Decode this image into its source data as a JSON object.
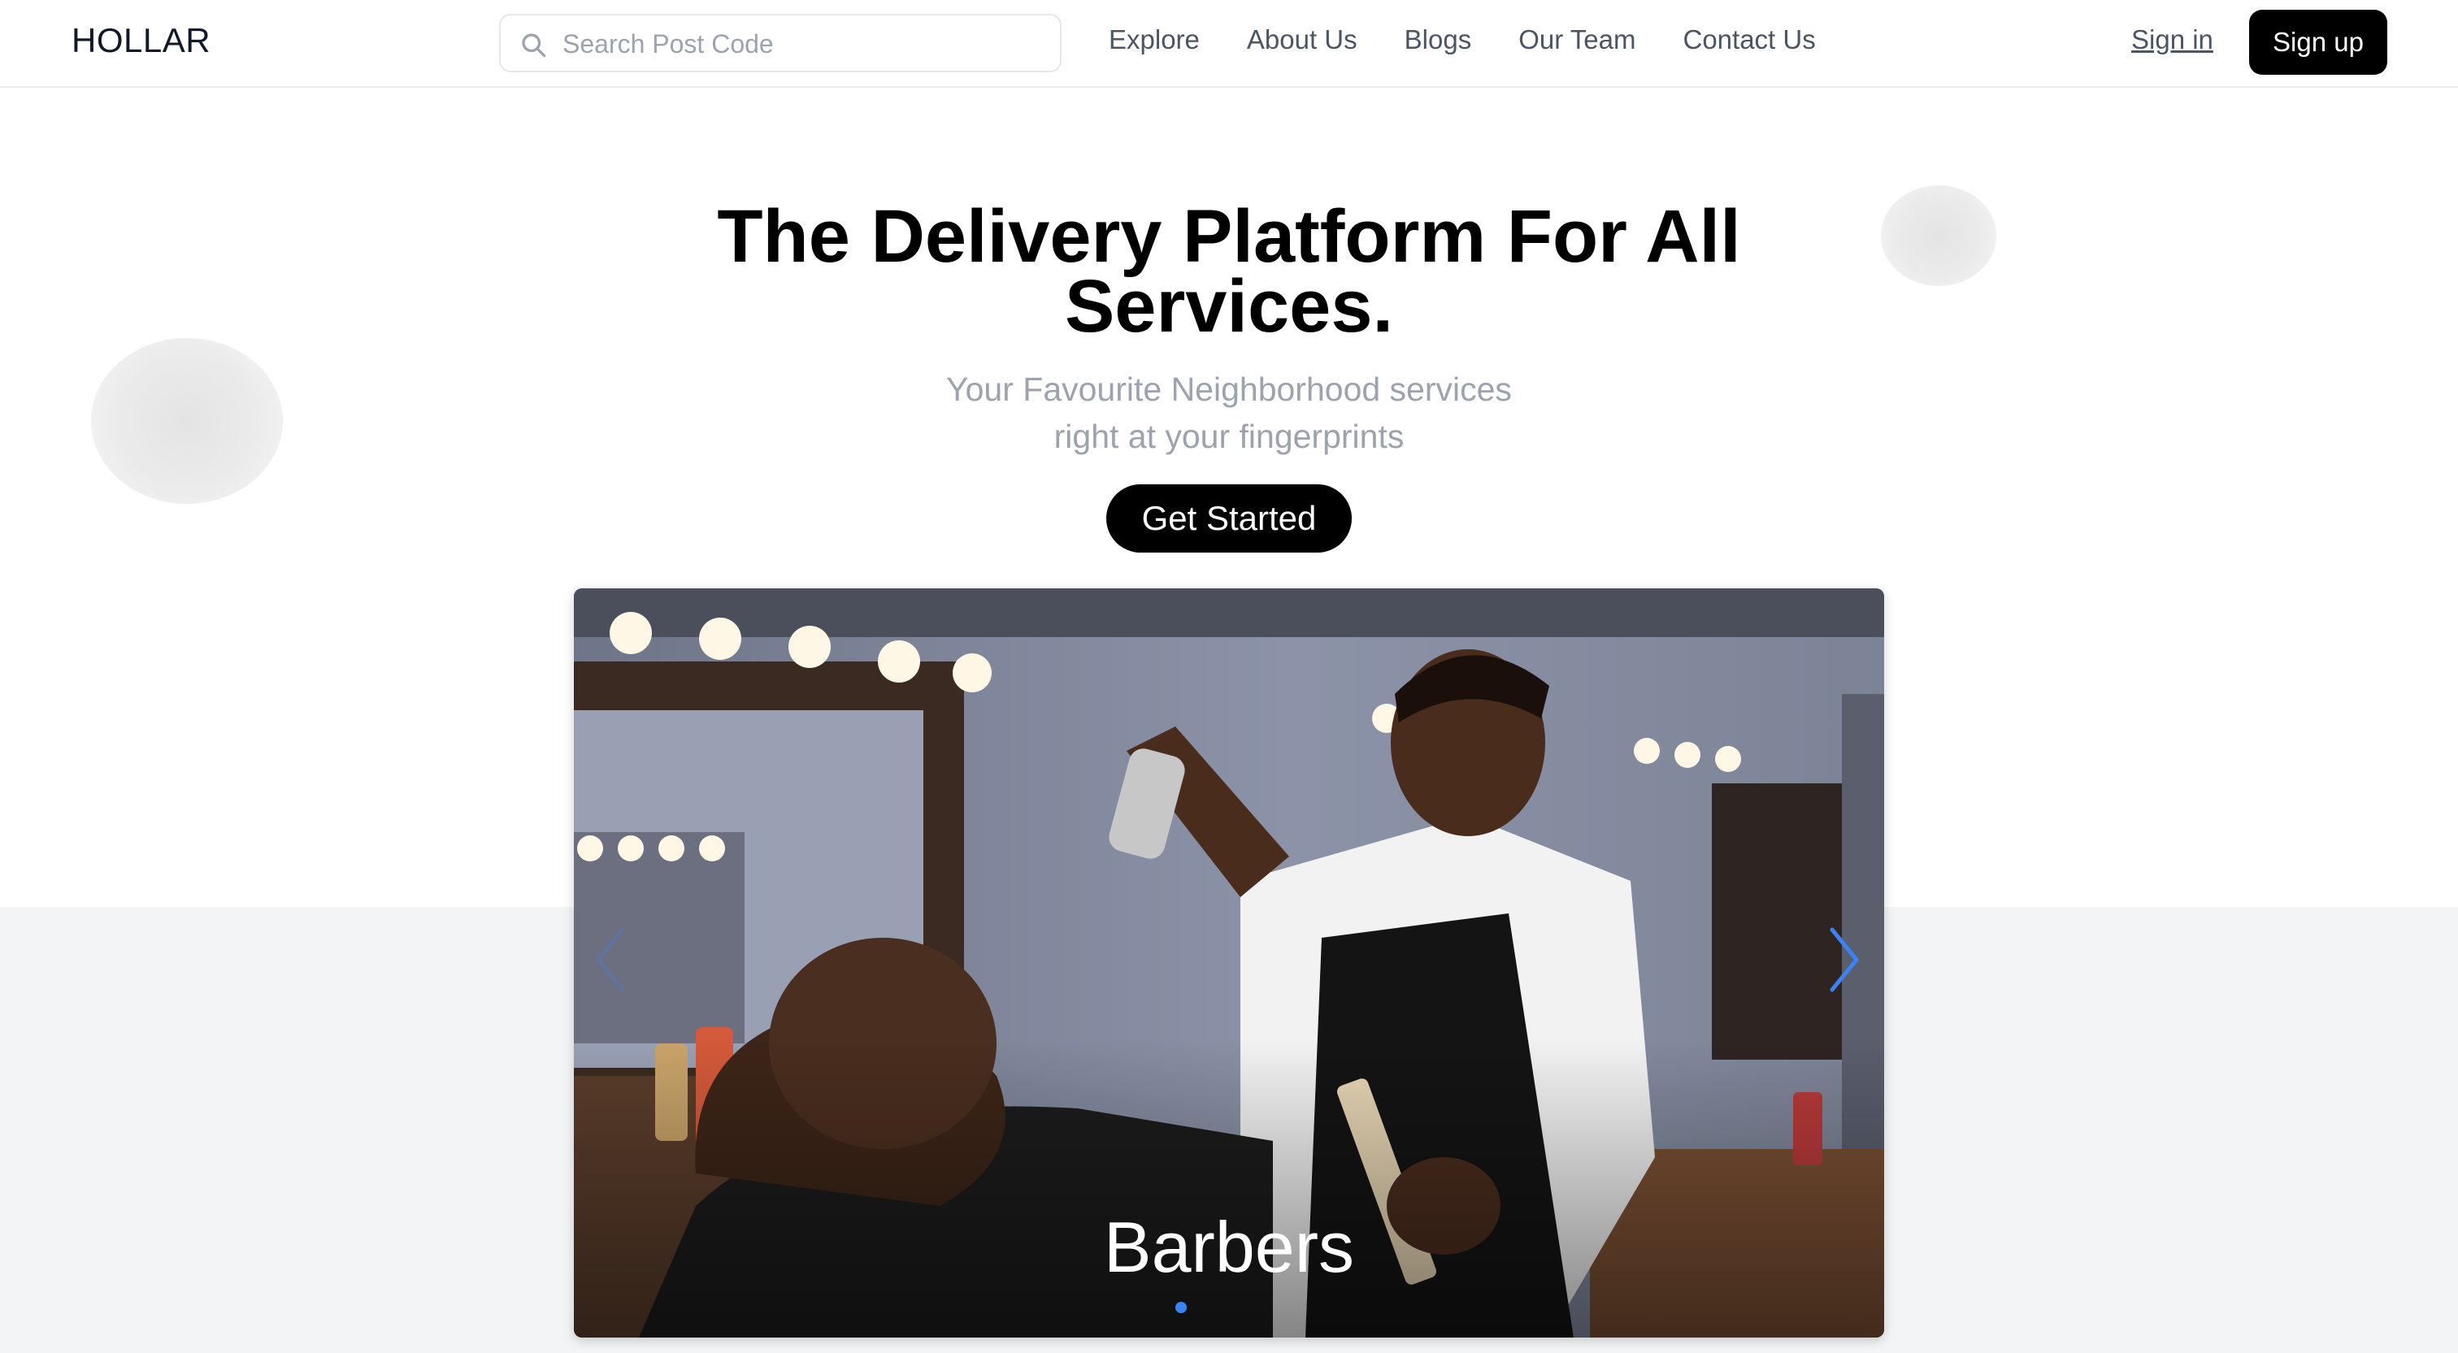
{
  "brand": "HOLLAR",
  "search": {
    "placeholder": "Search Post Code",
    "icon": "search-icon"
  },
  "nav": {
    "links": [
      {
        "label": "Explore"
      },
      {
        "label": "About Us"
      },
      {
        "label": "Blogs"
      },
      {
        "label": "Our Team"
      },
      {
        "label": "Contact Us"
      }
    ],
    "signin_label": "Sign in",
    "signup_label": "Sign up"
  },
  "hero": {
    "title_line1": "The Delivery Platform For All",
    "title_line2": "Services.",
    "subtitle_line1": "Your Favourite Neighborhood services",
    "subtitle_line2": "right at your fingerprints",
    "cta_label": "Get Started"
  },
  "carousel": {
    "active_slide": {
      "caption": "Barbers"
    },
    "active_index": 0,
    "slide_count": 1
  },
  "colors": {
    "primary": "#000000",
    "accent": "#3b82f6",
    "muted_text": "#9ca3af",
    "nav_text": "#4b5563",
    "band": "#f3f4f6"
  }
}
